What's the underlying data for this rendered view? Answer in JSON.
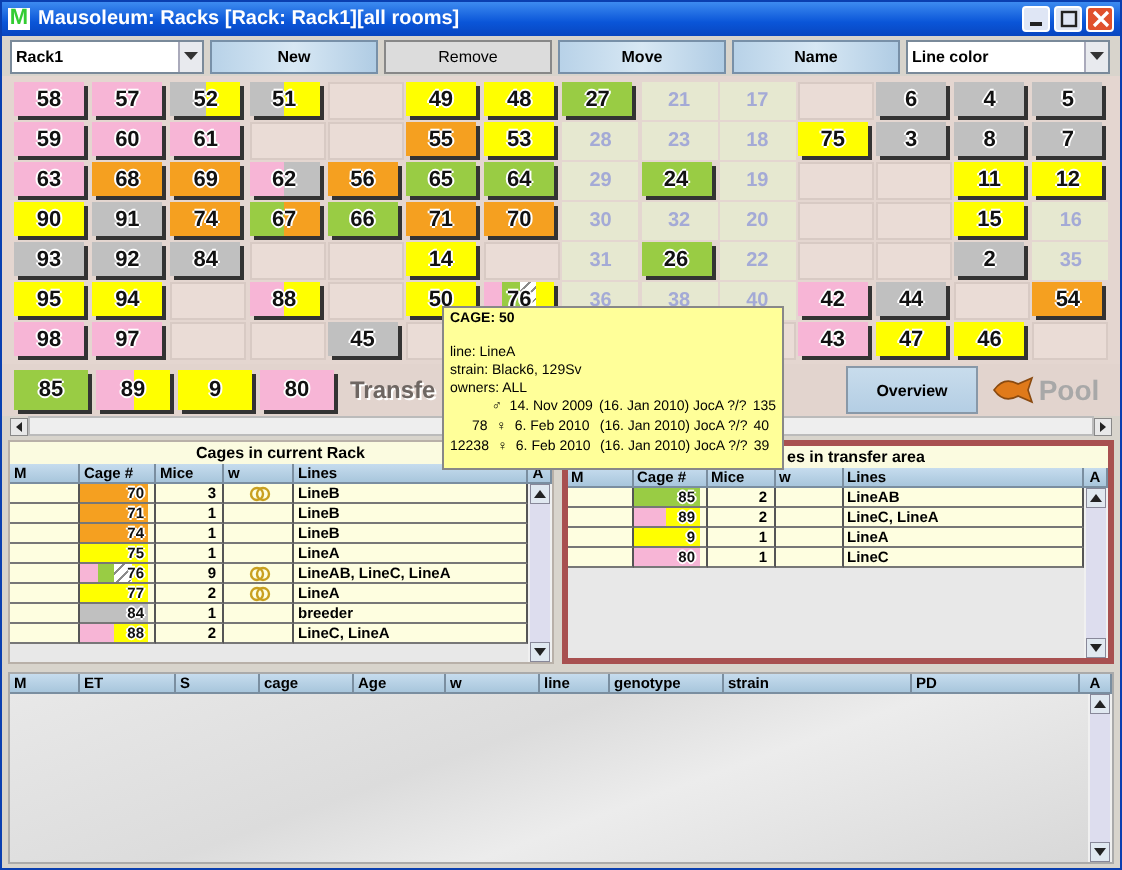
{
  "window": {
    "title": "Mausoleum: Racks [Rack: Rack1][all rooms]",
    "logo": "M"
  },
  "toolbar": {
    "rack_select": "Rack1",
    "buttons": [
      {
        "label": "New",
        "highlighted": false
      },
      {
        "label": "Remove",
        "highlighted": true
      },
      {
        "label": "Move",
        "highlighted": false
      },
      {
        "label": "Name",
        "highlighted": false
      }
    ],
    "color_select": "Line color"
  },
  "rack": {
    "rows": [
      {
        "cells": [
          {
            "kind": "cage",
            "number": "58",
            "segments": [
              {
                "color": "#f7b5d6",
                "striped": false
              }
            ]
          },
          {
            "kind": "cage",
            "number": "57",
            "segments": [
              {
                "color": "#f7b5d6",
                "striped": false
              }
            ]
          },
          {
            "kind": "cage",
            "number": "52",
            "segments": [
              {
                "color": "#c0c0c0",
                "striped": false
              },
              {
                "color": "#ffff00",
                "striped": false
              }
            ]
          },
          {
            "kind": "cage",
            "number": "51",
            "segments": [
              {
                "color": "#c0c0c0",
                "striped": false
              },
              {
                "color": "#ffff00",
                "striped": false
              }
            ]
          },
          {
            "kind": "empty"
          },
          {
            "kind": "cage",
            "number": "49",
            "segments": [
              {
                "color": "#ffff00",
                "striped": false
              }
            ]
          },
          {
            "kind": "cage",
            "number": "48",
            "segments": [
              {
                "color": "#ffff00",
                "striped": false
              }
            ]
          },
          {
            "kind": "cage",
            "number": "27",
            "segments": [
              {
                "color": "#99cc44",
                "striped": false
              }
            ]
          },
          {
            "kind": "slot",
            "number": "21"
          },
          {
            "kind": "slot",
            "number": "17"
          },
          {
            "kind": "empty"
          },
          {
            "kind": "cage",
            "number": "6",
            "segments": [
              {
                "color": "#c0c0c0",
                "striped": false
              }
            ]
          },
          {
            "kind": "cage",
            "number": "4",
            "segments": [
              {
                "color": "#c0c0c0",
                "striped": false
              }
            ]
          },
          {
            "kind": "cage",
            "number": "5",
            "segments": [
              {
                "color": "#c0c0c0",
                "striped": false
              }
            ]
          }
        ]
      },
      {
        "cells": [
          {
            "kind": "cage",
            "number": "59",
            "segments": [
              {
                "color": "#f7b5d6",
                "striped": false
              }
            ]
          },
          {
            "kind": "cage",
            "number": "60",
            "segments": [
              {
                "color": "#f7b5d6",
                "striped": false
              }
            ]
          },
          {
            "kind": "cage",
            "number": "61",
            "segments": [
              {
                "color": "#f7b5d6",
                "striped": false
              }
            ]
          },
          {
            "kind": "empty"
          },
          {
            "kind": "empty"
          },
          {
            "kind": "cage",
            "number": "55",
            "segments": [
              {
                "color": "#f5a020",
                "striped": false
              }
            ]
          },
          {
            "kind": "cage",
            "number": "53",
            "segments": [
              {
                "color": "#ffff00",
                "striped": false
              }
            ]
          },
          {
            "kind": "slot",
            "number": "28"
          },
          {
            "kind": "slot",
            "number": "23"
          },
          {
            "kind": "slot",
            "number": "18"
          },
          {
            "kind": "cage",
            "number": "75",
            "segments": [
              {
                "color": "#ffff00",
                "striped": false
              }
            ]
          },
          {
            "kind": "cage",
            "number": "3",
            "segments": [
              {
                "color": "#c0c0c0",
                "striped": false
              }
            ]
          },
          {
            "kind": "cage",
            "number": "8",
            "segments": [
              {
                "color": "#c0c0c0",
                "striped": false
              }
            ]
          },
          {
            "kind": "cage",
            "number": "7",
            "segments": [
              {
                "color": "#c0c0c0",
                "striped": false
              }
            ]
          }
        ]
      },
      {
        "cells": [
          {
            "kind": "cage",
            "number": "63",
            "segments": [
              {
                "color": "#f7b5d6",
                "striped": false
              }
            ]
          },
          {
            "kind": "cage",
            "number": "68",
            "segments": [
              {
                "color": "#f5a020",
                "striped": false
              }
            ]
          },
          {
            "kind": "cage",
            "number": "69",
            "segments": [
              {
                "color": "#f5a020",
                "striped": false
              }
            ]
          },
          {
            "kind": "cage",
            "number": "62",
            "segments": [
              {
                "color": "#f7b5d6",
                "striped": false
              },
              {
                "color": "#c0c0c0",
                "striped": false
              }
            ]
          },
          {
            "kind": "cage",
            "number": "56",
            "segments": [
              {
                "color": "#f5a020",
                "striped": false
              }
            ]
          },
          {
            "kind": "cage",
            "number": "65",
            "segments": [
              {
                "color": "#99cc44",
                "striped": false
              }
            ]
          },
          {
            "kind": "cage",
            "number": "64",
            "segments": [
              {
                "color": "#99cc44",
                "striped": false
              }
            ]
          },
          {
            "kind": "slot",
            "number": "29"
          },
          {
            "kind": "cage",
            "number": "24",
            "segments": [
              {
                "color": "#99cc44",
                "striped": false
              }
            ]
          },
          {
            "kind": "slot",
            "number": "19"
          },
          {
            "kind": "empty"
          },
          {
            "kind": "empty"
          },
          {
            "kind": "cage",
            "number": "11",
            "segments": [
              {
                "color": "#ffff00",
                "striped": false
              }
            ]
          },
          {
            "kind": "cage",
            "number": "12",
            "segments": [
              {
                "color": "#ffff00",
                "striped": false
              }
            ]
          }
        ]
      },
      {
        "cells": [
          {
            "kind": "cage",
            "number": "90",
            "segments": [
              {
                "color": "#ffff00",
                "striped": false
              }
            ]
          },
          {
            "kind": "cage",
            "number": "91",
            "segments": [
              {
                "color": "#c0c0c0",
                "striped": false
              }
            ]
          },
          {
            "kind": "cage",
            "number": "74",
            "segments": [
              {
                "color": "#f5a020",
                "striped": false
              }
            ]
          },
          {
            "kind": "cage",
            "number": "67",
            "segments": [
              {
                "color": "#99cc44",
                "striped": false
              },
              {
                "color": "#f5a020",
                "striped": false
              }
            ]
          },
          {
            "kind": "cage",
            "number": "66",
            "segments": [
              {
                "color": "#99cc44",
                "striped": false
              }
            ]
          },
          {
            "kind": "cage",
            "number": "71",
            "segments": [
              {
                "color": "#f5a020",
                "striped": false
              }
            ]
          },
          {
            "kind": "cage",
            "number": "70",
            "segments": [
              {
                "color": "#f5a020",
                "striped": false
              }
            ]
          },
          {
            "kind": "slot",
            "number": "30"
          },
          {
            "kind": "slot",
            "number": "32"
          },
          {
            "kind": "slot",
            "number": "20"
          },
          {
            "kind": "empty"
          },
          {
            "kind": "empty"
          },
          {
            "kind": "cage",
            "number": "15",
            "segments": [
              {
                "color": "#ffff00",
                "striped": false
              }
            ]
          },
          {
            "kind": "slot",
            "number": "16"
          }
        ]
      },
      {
        "cells": [
          {
            "kind": "cage",
            "number": "93",
            "segments": [
              {
                "color": "#c0c0c0",
                "striped": false
              }
            ]
          },
          {
            "kind": "cage",
            "number": "92",
            "segments": [
              {
                "color": "#c0c0c0",
                "striped": false
              }
            ]
          },
          {
            "kind": "cage",
            "number": "84",
            "segments": [
              {
                "color": "#c0c0c0",
                "striped": false
              }
            ]
          },
          {
            "kind": "empty"
          },
          {
            "kind": "empty"
          },
          {
            "kind": "cage",
            "number": "14",
            "segments": [
              {
                "color": "#ffff00",
                "striped": false
              }
            ]
          },
          {
            "kind": "empty"
          },
          {
            "kind": "slot",
            "number": "31"
          },
          {
            "kind": "cage",
            "number": "26",
            "segments": [
              {
                "color": "#99cc44",
                "striped": false
              }
            ]
          },
          {
            "kind": "slot",
            "number": "22"
          },
          {
            "kind": "empty"
          },
          {
            "kind": "empty"
          },
          {
            "kind": "cage",
            "number": "2",
            "segments": [
              {
                "color": "#c0c0c0",
                "striped": false
              }
            ]
          },
          {
            "kind": "slot",
            "number": "35"
          }
        ]
      },
      {
        "cells": [
          {
            "kind": "cage",
            "number": "95",
            "segments": [
              {
                "color": "#ffff00",
                "striped": false
              }
            ]
          },
          {
            "kind": "cage",
            "number": "94",
            "segments": [
              {
                "color": "#ffff00",
                "striped": false
              }
            ]
          },
          {
            "kind": "empty"
          },
          {
            "kind": "cage",
            "number": "88",
            "segments": [
              {
                "color": "#f7b5d6",
                "striped": false
              },
              {
                "color": "#ffff00",
                "striped": false
              }
            ]
          },
          {
            "kind": "empty"
          },
          {
            "kind": "cage",
            "number": "50",
            "segments": [
              {
                "color": "#ffff00",
                "striped": false
              }
            ]
          },
          {
            "kind": "cage",
            "number": "76",
            "segments": [
              {
                "color": "#f7b5d6",
                "striped": false
              },
              {
                "color": "#99cc44",
                "striped": false
              },
              {
                "color": "#ffffff",
                "striped": true
              },
              {
                "color": "#ffff00",
                "striped": false
              }
            ]
          },
          {
            "kind": "slot",
            "number": "36"
          },
          {
            "kind": "slot",
            "number": "38"
          },
          {
            "kind": "slot",
            "number": "40"
          },
          {
            "kind": "cage",
            "number": "42",
            "segments": [
              {
                "color": "#f7b5d6",
                "striped": false
              }
            ]
          },
          {
            "kind": "cage",
            "number": "44",
            "segments": [
              {
                "color": "#c0c0c0",
                "striped": false
              }
            ]
          },
          {
            "kind": "empty"
          },
          {
            "kind": "cage",
            "number": "54",
            "segments": [
              {
                "color": "#f5a020",
                "striped": false
              }
            ]
          }
        ]
      },
      {
        "cells": [
          {
            "kind": "cage",
            "number": "98",
            "segments": [
              {
                "color": "#f7b5d6",
                "striped": false
              }
            ]
          },
          {
            "kind": "cage",
            "number": "97",
            "segments": [
              {
                "color": "#f7b5d6",
                "striped": false
              }
            ]
          },
          {
            "kind": "empty"
          },
          {
            "kind": "empty"
          },
          {
            "kind": "cage",
            "number": "45",
            "segments": [
              {
                "color": "#c0c0c0",
                "striped": false
              }
            ]
          },
          {
            "kind": "empty"
          },
          {
            "kind": "covered"
          },
          {
            "kind": "covered"
          },
          {
            "kind": "covered"
          },
          {
            "kind": "empty"
          },
          {
            "kind": "cage",
            "number": "43",
            "segments": [
              {
                "color": "#f7b5d6",
                "striped": false
              }
            ]
          },
          {
            "kind": "cage",
            "number": "47",
            "segments": [
              {
                "color": "#ffff00",
                "striped": false
              }
            ]
          },
          {
            "kind": "cage",
            "number": "46",
            "segments": [
              {
                "color": "#ffff00",
                "striped": false
              }
            ]
          },
          {
            "kind": "empty"
          }
        ]
      }
    ]
  },
  "transfer_strip": {
    "cages": [
      {
        "number": "85",
        "segments": [
          {
            "color": "#99cc44",
            "striped": false
          }
        ]
      },
      {
        "number": "89",
        "segments": [
          {
            "color": "#f7b5d6",
            "striped": false
          },
          {
            "color": "#ffff00",
            "striped": false
          }
        ]
      },
      {
        "number": "9",
        "segments": [
          {
            "color": "#ffff00",
            "striped": false
          }
        ]
      },
      {
        "number": "80",
        "segments": [
          {
            "color": "#f7b5d6",
            "striped": false
          }
        ]
      }
    ],
    "label": "Transfe",
    "overview_button": "Overview",
    "pool_label": "Pool"
  },
  "tooltip": {
    "title": "CAGE: 50",
    "line": "line: LineA",
    "strain": "strain: Black6, 129Sv",
    "owners": "owners: ALL",
    "mice": [
      {
        "sex": "♂",
        "born": "14. Nov 2009",
        "weaned": "(16. Jan 2010)",
        "owner": "JocA ?/?",
        "age": "135"
      },
      {
        "id": "78",
        "sex": "♀",
        "born": "6. Feb 2010",
        "weaned": "(16. Jan 2010)",
        "owner": "JocA ?/?",
        "age": "40"
      },
      {
        "id": "12238",
        "sex": "♀",
        "born": "6. Feb 2010",
        "weaned": "(16. Jan 2010)",
        "owner": "JocA ?/?",
        "age": "39"
      }
    ]
  },
  "rack_cages": {
    "title": "Cages in current Rack",
    "columns": [
      "M",
      "Cage #",
      "Mice",
      "w",
      "Lines",
      "A"
    ],
    "rows": [
      {
        "cage": "70",
        "segments": [
          {
            "color": "#f5a020",
            "striped": false
          }
        ],
        "mice": "3",
        "rings": true,
        "lines": "LineB"
      },
      {
        "cage": "71",
        "segments": [
          {
            "color": "#f5a020",
            "striped": false
          }
        ],
        "mice": "1",
        "rings": false,
        "lines": "LineB"
      },
      {
        "cage": "74",
        "segments": [
          {
            "color": "#f5a020",
            "striped": false
          }
        ],
        "mice": "1",
        "rings": false,
        "lines": "LineB"
      },
      {
        "cage": "75",
        "segments": [
          {
            "color": "#ffff00",
            "striped": false
          }
        ],
        "mice": "1",
        "rings": false,
        "lines": "LineA"
      },
      {
        "cage": "76",
        "segments": [
          {
            "color": "#f7b5d6",
            "striped": false
          },
          {
            "color": "#99cc44",
            "striped": false
          },
          {
            "color": "#ffffff",
            "striped": true
          },
          {
            "color": "#ffff00",
            "striped": false
          }
        ],
        "mice": "9",
        "rings": true,
        "lines": "LineAB, LineC, LineA"
      },
      {
        "cage": "77",
        "segments": [
          {
            "color": "#ffff00",
            "striped": false
          }
        ],
        "mice": "2",
        "rings": true,
        "lines": "LineA"
      },
      {
        "cage": "84",
        "segments": [
          {
            "color": "#c0c0c0",
            "striped": false
          }
        ],
        "mice": "1",
        "rings": false,
        "lines": "breeder"
      },
      {
        "cage": "88",
        "segments": [
          {
            "color": "#f7b5d6",
            "striped": false
          },
          {
            "color": "#ffff00",
            "striped": false
          }
        ],
        "mice": "2",
        "rings": false,
        "lines": "LineC, LineA"
      }
    ]
  },
  "transfer_cages": {
    "title": "es in transfer area",
    "columns": [
      "M",
      "Cage #",
      "Mice",
      "w",
      "Lines",
      "A"
    ],
    "rows": [
      {
        "cage": "85",
        "segments": [
          {
            "color": "#99cc44",
            "striped": false
          }
        ],
        "mice": "2",
        "rings": false,
        "lines": "LineAB"
      },
      {
        "cage": "89",
        "segments": [
          {
            "color": "#f7b5d6",
            "striped": false
          },
          {
            "color": "#ffff00",
            "striped": false
          }
        ],
        "mice": "2",
        "rings": false,
        "lines": "LineC, LineA"
      },
      {
        "cage": "9",
        "segments": [
          {
            "color": "#ffff00",
            "striped": false
          }
        ],
        "mice": "1",
        "rings": false,
        "lines": "LineA"
      },
      {
        "cage": "80",
        "segments": [
          {
            "color": "#f7b5d6",
            "striped": false
          }
        ],
        "mice": "1",
        "rings": false,
        "lines": "LineC"
      }
    ]
  },
  "mice_table": {
    "columns": [
      "M",
      "ET",
      "S",
      "cage",
      "Age",
      "w",
      "line",
      "genotype",
      "strain",
      "PD",
      "A"
    ]
  }
}
